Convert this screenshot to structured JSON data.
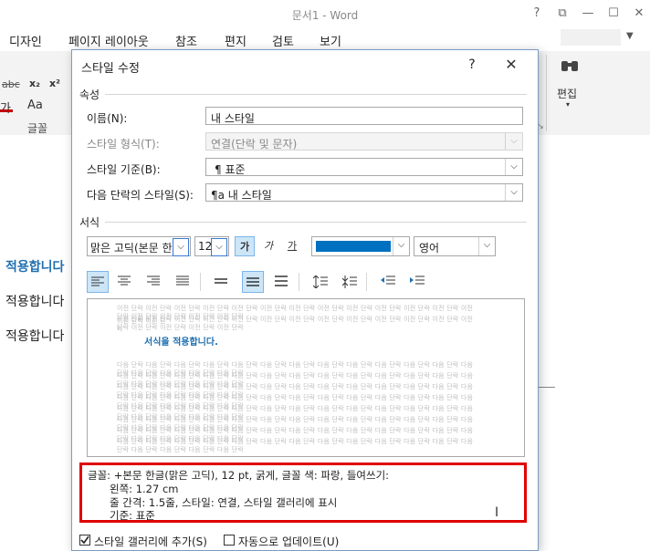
{
  "app": {
    "title": "문서1 - Word",
    "controls": {
      "help": "?",
      "ribbon_display": "⧉",
      "minimize": "—",
      "maximize": "☐",
      "close": "✕"
    }
  },
  "menu": {
    "items": [
      "디자인",
      "페이지 레이아웃",
      "참조",
      "편지",
      "검토",
      "보기"
    ]
  },
  "ribbon": {
    "font_group_label": "글꼴",
    "font_buttons": [
      "abc",
      "x₂",
      "x²"
    ],
    "font_row2": [
      "가",
      "Aa"
    ],
    "edit_label": "편집",
    "edit_icon": "binoculars-icon"
  },
  "document": {
    "lines": [
      "적용합니다",
      "적용합니다",
      "적용합니다"
    ]
  },
  "dialog": {
    "title": "스타일 수정",
    "help": "?",
    "close": "✕",
    "properties_section": "속성",
    "fields": [
      {
        "label": "이름(N):",
        "value": "내 스타일",
        "disabled": false,
        "combo": false
      },
      {
        "label": "스타일 형식(T):",
        "value": "연결(단락 및 문자)",
        "disabled": true,
        "combo": true
      },
      {
        "label": "스타일 기준(B):",
        "value": "¶ 표준",
        "disabled": false,
        "combo": true
      },
      {
        "label": "다음 단락의 스타일(S):",
        "value": "¶a 내 스타일",
        "disabled": false,
        "combo": true
      }
    ],
    "format_section": "서식",
    "font_name": "맑은 고딕(본문 한",
    "font_size": "12",
    "bold": "가",
    "italic": "가",
    "underline": "가",
    "font_color": "#0070c0",
    "language": "영어",
    "paragraph_buttons": [
      "align-left-icon",
      "align-center-icon",
      "align-right-icon",
      "justify-icon",
      "single-spacing-icon",
      "one-half-spacing-icon",
      "double-spacing-icon",
      "increase-para-spacing-icon",
      "decrease-para-spacing-icon",
      "decrease-indent-icon",
      "increase-indent-icon"
    ],
    "preview": {
      "filler": "이전 단락 이전 단락 이전 단락 이전 단락 이전 단락 이전 단락 이전 단락 이전 단락 이전 단락 이전 단락 이전 단락 이전 단락 이전 단락 이전 단락 이전 단락 이전 단락 이전 단락",
      "filler_short": "이전 단락 이전 단락",
      "sample_text": "서식을 적용합니다.",
      "following": "다음 단락 다음 단락 다음 단락 다음 단락 다음 단락 다음 단락 다음 단락 다음 단락 다음 단락 다음 단락 다음 단락 다음 단락 다음 단락 다음 단락 다음 단락 다음 단락 다음 단락"
    },
    "description": [
      "글꼴: +본문 한글(맑은 고딕), 12 pt, 굵게, 글꼴 색: 파랑, 들여쓰기:",
      "왼쪽:  1.27 cm",
      "줄 간격: 1.5줄, 스타일: 연결, 스타일 갤러리에 표시",
      "기준: 표준"
    ],
    "add_to_gallery": {
      "label": "스타일 갤러리에 추가(S)",
      "checked": true
    },
    "auto_update": {
      "label": "자동으로 업데이트(U)",
      "checked": false
    }
  }
}
